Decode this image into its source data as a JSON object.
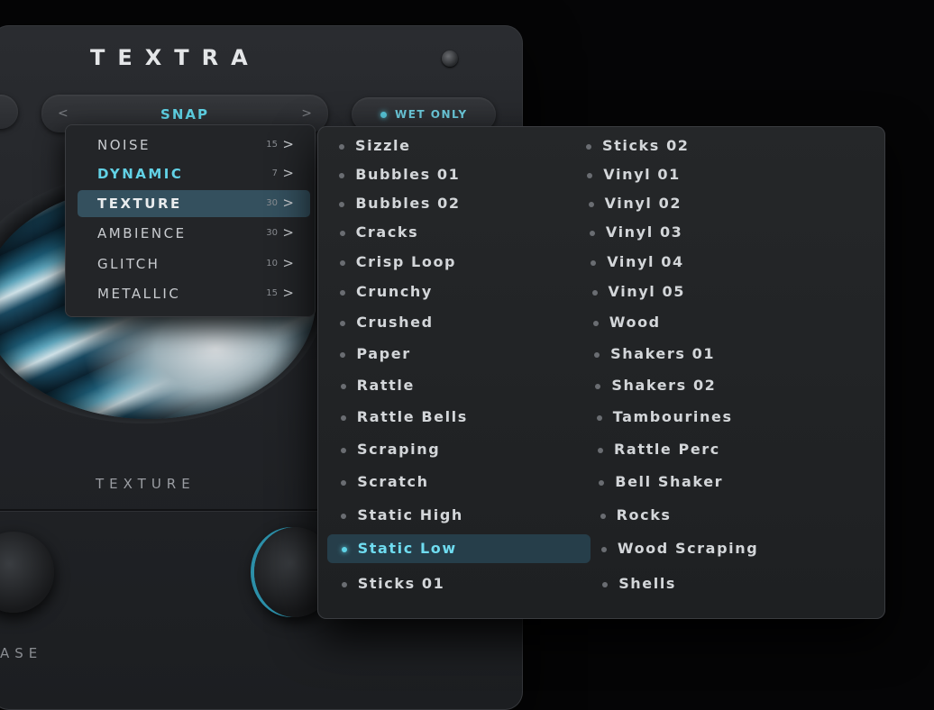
{
  "app": {
    "title": "TEXTRA"
  },
  "header": {
    "preset_label": "SNAP",
    "prev_chevron": "<",
    "next_chevron": ">",
    "wet_only_label": "WET ONLY"
  },
  "module": {
    "texture_label": "TEXTURE",
    "bottom_label_partial": "ASE"
  },
  "colors": {
    "accent": "#5fd3e6",
    "panel": "#232528",
    "selected": "#34505e",
    "background": "#050506"
  },
  "categories": [
    {
      "label": "NOISE",
      "count": "15",
      "arrow": ">"
    },
    {
      "label": "DYNAMIC",
      "count": "7",
      "arrow": ">"
    },
    {
      "label": "TEXTURE",
      "count": "30",
      "arrow": ">"
    },
    {
      "label": "AMBIENCE",
      "count": "30",
      "arrow": ">"
    },
    {
      "label": "GLITCH",
      "count": "10",
      "arrow": ">"
    },
    {
      "label": "METALLIC",
      "count": "15",
      "arrow": ">"
    }
  ],
  "presets_col1": [
    "Sizzle",
    "Bubbles 01",
    "Bubbles 02",
    "Cracks",
    "Crisp Loop",
    "Crunchy",
    "Crushed",
    "Paper",
    "Rattle",
    "Rattle Bells",
    "Scraping",
    "Scratch",
    "Static High",
    "Static Low",
    "Sticks 01"
  ],
  "presets_col2": [
    "Sticks 02",
    "Vinyl 01",
    "Vinyl 02",
    "Vinyl 03",
    "Vinyl 04",
    "Vinyl 05",
    "Wood",
    "Shakers 01",
    "Shakers 02",
    "Tambourines",
    "Rattle Perc",
    "Bell Shaker",
    "Rocks",
    "Wood Scraping",
    "Shells"
  ],
  "selected_preset": "Static Low"
}
